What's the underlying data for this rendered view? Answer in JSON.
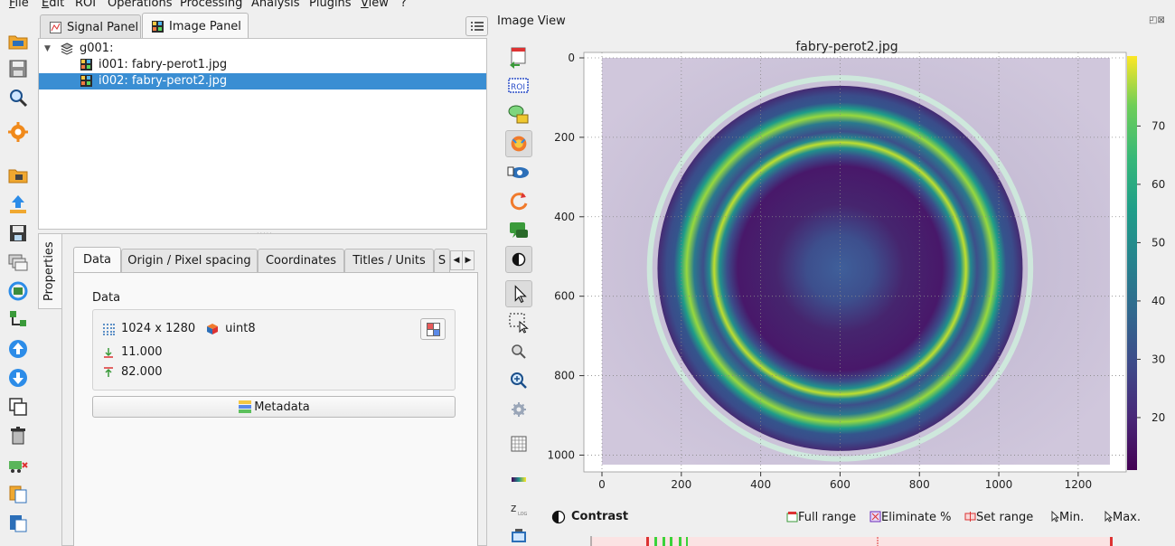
{
  "menu": {
    "items": [
      {
        "name": "File",
        "underline": "F",
        "rest": "ile"
      },
      {
        "name": "Edit",
        "underline": "E",
        "rest": "dit"
      },
      {
        "name": "ROI",
        "underline": "",
        "rest": "ROI"
      },
      {
        "name": "Operations",
        "underline": "",
        "rest": "Operations"
      },
      {
        "name": "Processing",
        "underline": "",
        "rest": "Processing"
      },
      {
        "name": "Analysis",
        "underline": "",
        "rest": "Analysis"
      },
      {
        "name": "Plugins",
        "underline": "",
        "rest": "Plugins"
      },
      {
        "name": "View",
        "underline": "V",
        "rest": "iew"
      },
      {
        "name": "?",
        "underline": "",
        "rest": "?"
      }
    ]
  },
  "panels": {
    "signal_tab": "Signal Panel",
    "image_tab": "Image Panel"
  },
  "tree": {
    "group": "g001:",
    "items": [
      {
        "label": "i001: fabry-perot1.jpg",
        "selected": false
      },
      {
        "label": "i002: fabry-perot2.jpg",
        "selected": true
      }
    ]
  },
  "properties": {
    "side_label": "Properties",
    "tabs": [
      "Data",
      "Origin / Pixel spacing",
      "Coordinates",
      "Titles / Units",
      "S"
    ],
    "active_tab": "Data",
    "group_title": "Data",
    "size": "1024 x 1280",
    "dtype": "uint8",
    "min_value": "11.000",
    "max_value": "82.000",
    "metadata_button": "Metadata"
  },
  "image_view": {
    "title": "Image View",
    "window_controls": "◰⊠",
    "contrast_label": "Contrast",
    "contrast_buttons": [
      "Full range",
      "Eliminate %",
      "Set range",
      "Min.",
      "Max."
    ]
  },
  "colors": {
    "selection": "#3a8ed3",
    "accent_yellow": "#f7e531"
  },
  "chart_data": {
    "type": "heatmap",
    "title": "fabry-perot2.jpg",
    "x_ticks": [
      0,
      200,
      400,
      600,
      800,
      1000,
      1200
    ],
    "y_ticks": [
      0,
      200,
      400,
      600,
      800,
      1000
    ],
    "xlim": [
      0,
      1280
    ],
    "ylim": [
      1024,
      0
    ],
    "colorbar_ticks": [
      20,
      30,
      40,
      50,
      60,
      70
    ],
    "colorbar_range": [
      11,
      82
    ],
    "colormap": "viridis",
    "grid": true,
    "ring_center": [
      600,
      530
    ],
    "ring_radii": [
      90,
      150,
      210,
      260,
      330,
      395,
      440,
      480
    ]
  }
}
